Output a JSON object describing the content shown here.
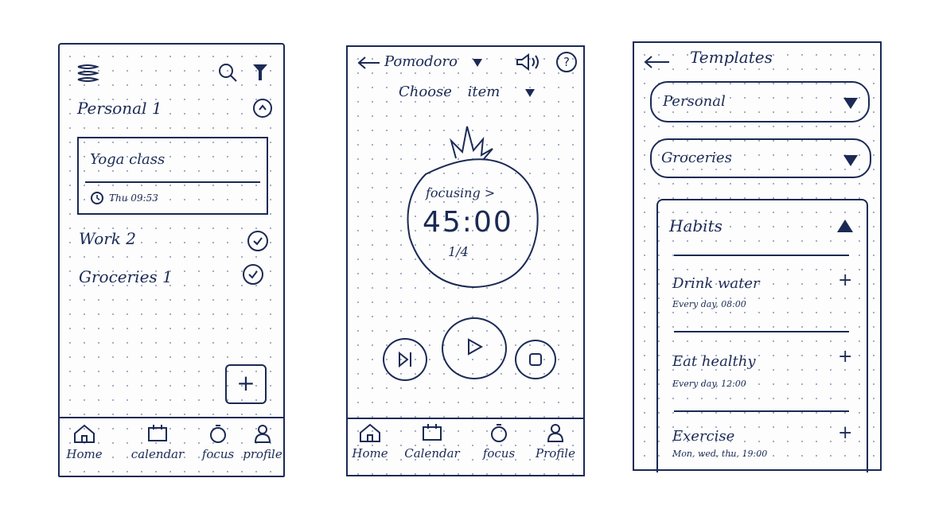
{
  "screen1": {
    "categories": [
      {
        "label": "Personal 1"
      },
      {
        "label": "Work 2"
      },
      {
        "label": "Groceries 1"
      }
    ],
    "task": {
      "title": "Yoga class",
      "time": "Thu 09:53"
    },
    "add_label": "+"
  },
  "screen2": {
    "title": "Pomodoro",
    "choose_label": "Choose item",
    "status": "focusing >",
    "timer": "45:00",
    "session": "1/4"
  },
  "screen3": {
    "title": "Templates",
    "dropdowns": [
      {
        "label": "Personal"
      },
      {
        "label": "Groceries"
      }
    ],
    "section_title": "Habits",
    "habits": [
      {
        "name": "Drink water",
        "schedule": "Every day, 08:00"
      },
      {
        "name": "Eat healthy",
        "schedule": "Every day, 12:00"
      },
      {
        "name": "Exercise",
        "schedule": "Mon, wed, thu, 19:00"
      }
    ]
  },
  "nav": {
    "screen1": [
      "Home",
      "calendar",
      "focus",
      "profile"
    ],
    "screen2": [
      "Home",
      "Calendar",
      "focus",
      "Profile"
    ]
  }
}
